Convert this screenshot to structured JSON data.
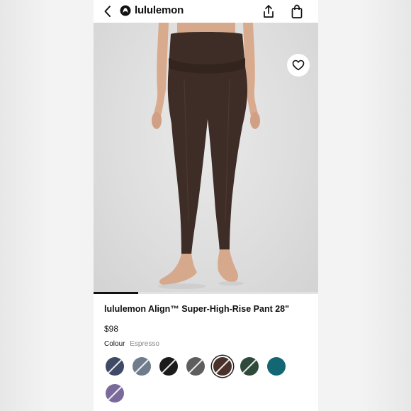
{
  "header": {
    "brand_name": "lululemon",
    "icons": [
      "chevron-left-icon",
      "lululemon-logo-icon",
      "share-icon",
      "shopping-bag-icon"
    ]
  },
  "product": {
    "title": "lululemon Align™ Super-High-Rise Pant 28\"",
    "price": "$98",
    "colour_label": "Colour",
    "colour_value": "Espresso",
    "gallery_progress": 0.2,
    "wishlist_icon": "heart-icon"
  },
  "colors": {
    "swatches": [
      {
        "name": "navy",
        "hex": "#3e4a66",
        "slashed": true
      },
      {
        "name": "slate-blue",
        "hex": "#6e7c8c",
        "slashed": true
      },
      {
        "name": "black",
        "hex": "#1b1b1b",
        "slashed": true
      },
      {
        "name": "grey",
        "hex": "#5e5e5e",
        "slashed": true
      },
      {
        "name": "espresso",
        "hex": "#4a322b",
        "slashed": true,
        "selected": true
      },
      {
        "name": "dark-green",
        "hex": "#2d4a3a",
        "slashed": true
      },
      {
        "name": "teal",
        "hex": "#136673",
        "slashed": false
      },
      {
        "name": "lavender",
        "hex": "#7a6a9c",
        "slashed": true
      }
    ]
  }
}
